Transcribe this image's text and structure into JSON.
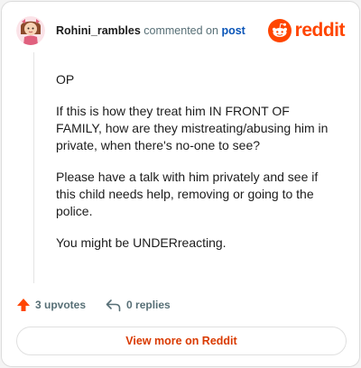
{
  "comment": {
    "username": "Rohini_rambles",
    "commented_text": "commented on",
    "post_link": "post",
    "paragraphs": [
      "OP",
      "If this is how they treat him IN FRONT OF FAMILY, how are they mistreating/abusing him in private, when there's no-one to see?",
      "Please have a talk with him privately and see if this child needs help, removing or going to the police.",
      "You might be UNDERreacting."
    ]
  },
  "brand": {
    "wordmark": "reddit",
    "color": "#ff4500",
    "icon": "reddit-logo-icon"
  },
  "actions": {
    "upvotes": "3 upvotes",
    "replies": "0 replies",
    "upvote_icon": "upvote-arrow-icon",
    "reply_icon": "reply-arrow-icon",
    "upvote_color": "#ff4500"
  },
  "footer": {
    "view_more": "View more on Reddit"
  }
}
